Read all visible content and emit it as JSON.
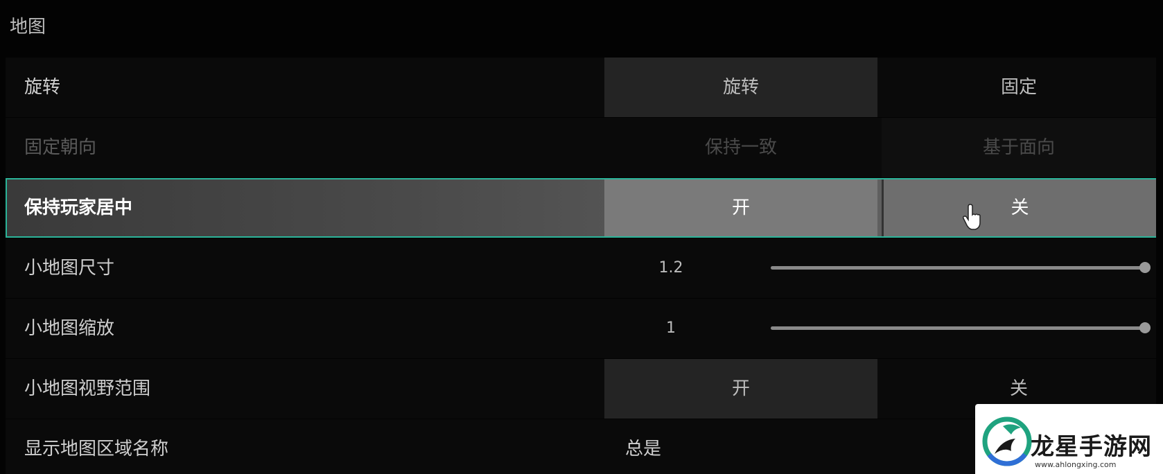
{
  "section": {
    "title": "地图"
  },
  "settings": {
    "rotation": {
      "label": "旋转",
      "options": [
        "旋转",
        "固定"
      ],
      "selected": 0
    },
    "fixed_orientation": {
      "label": "固定朝向",
      "options": [
        "保持一致",
        "基于面向"
      ],
      "selected": 0,
      "disabled": true
    },
    "keep_player_centered": {
      "label": "保持玩家居中",
      "options": [
        "开",
        "关"
      ],
      "selected": 0,
      "focused": true
    },
    "minimap_size": {
      "label": "小地图尺寸",
      "value": "1.2",
      "slider_fraction": 1.0
    },
    "minimap_zoom": {
      "label": "小地图缩放",
      "value": "1",
      "slider_fraction": 1.0
    },
    "minimap_fov": {
      "label": "小地图视野范围",
      "options": [
        "开",
        "关"
      ],
      "selected": 0
    },
    "show_area_names": {
      "label": "显示地图区域名称",
      "value": "总是"
    }
  },
  "watermark": {
    "text": "龙星手游网",
    "url": "www.ahlongxing.com"
  },
  "colors": {
    "focus_border": "#2bb59a",
    "background": "#030303"
  }
}
